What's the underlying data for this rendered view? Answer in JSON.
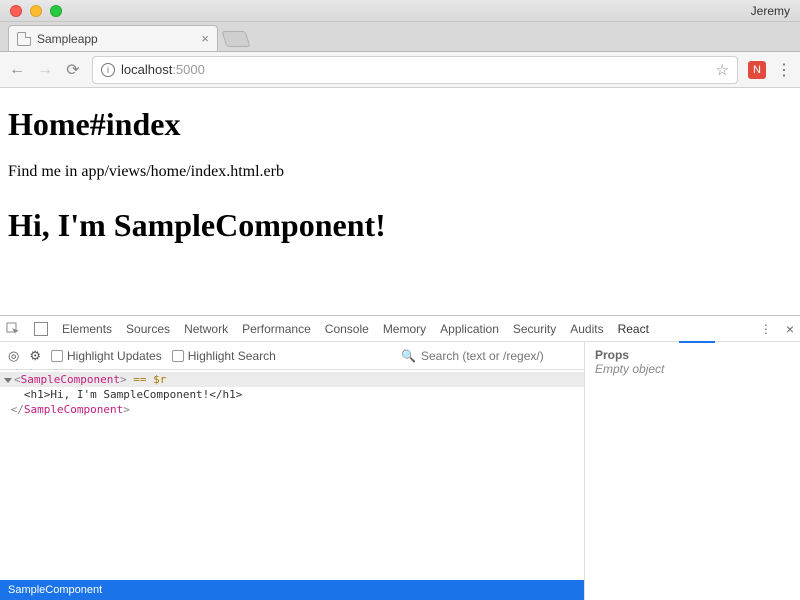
{
  "chrome": {
    "profile": "Jeremy",
    "tab_title": "Sampleapp",
    "url_host": "localhost",
    "url_port": ":5000",
    "extension_label": "N"
  },
  "page": {
    "heading": "Home#index",
    "subtext": "Find me in app/views/home/index.html.erb",
    "component_heading": "Hi, I'm SampleComponent!"
  },
  "devtools": {
    "tabs": [
      "Elements",
      "Sources",
      "Network",
      "Performance",
      "Console",
      "Memory",
      "Application",
      "Security",
      "Audits",
      "React"
    ],
    "active_tab": "React",
    "highlight_updates": "Highlight Updates",
    "highlight_search": "Highlight Search",
    "search_placeholder": "Search (text or /regex/)",
    "status": "SampleComponent",
    "props_header": "Props",
    "props_empty": "Empty object",
    "tree": {
      "line1_open": "<",
      "line1_name": "SampleComponent",
      "line1_close": ">",
      "line1_suffix": " == $r",
      "line2": "<h1>Hi, I'm SampleComponent!</h1>",
      "line3_open": "</",
      "line3_name": "SampleComponent",
      "line3_close": ">"
    }
  }
}
